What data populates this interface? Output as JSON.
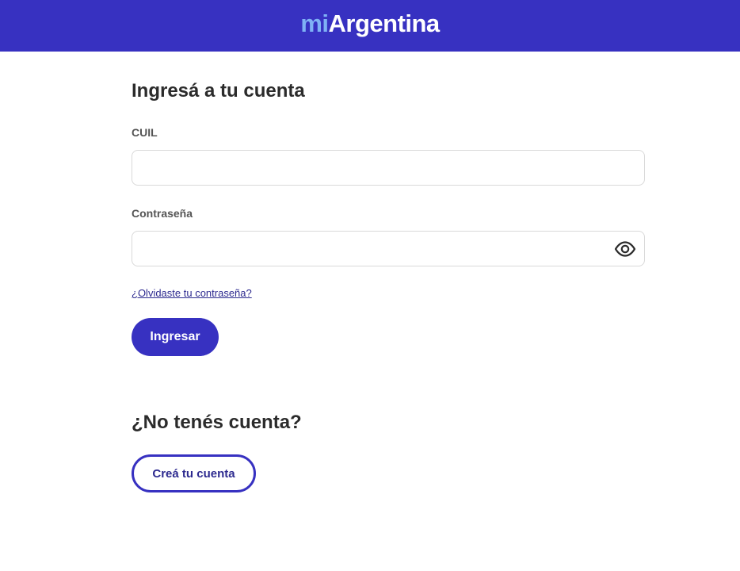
{
  "header": {
    "logo_prefix": "mi",
    "logo_suffix": "Argentina",
    "background_color": "#3731c1",
    "prefix_color": "#7fb2f5"
  },
  "login": {
    "title": "Ingresá a tu cuenta",
    "cuil_label": "CUIL",
    "cuil_value": "",
    "password_label": "Contraseña",
    "password_value": "",
    "password_toggle_icon": "eye-icon",
    "forgot_link": "¿Olvidaste tu contraseña?",
    "submit_label": "Ingresar"
  },
  "register": {
    "title": "¿No tenés cuenta?",
    "create_label": "Creá tu cuenta"
  },
  "colors": {
    "accent": "#3731c1",
    "link": "#2d2a8f",
    "text": "#2b2b2b",
    "label": "#555555",
    "border": "#d9d9d9"
  }
}
